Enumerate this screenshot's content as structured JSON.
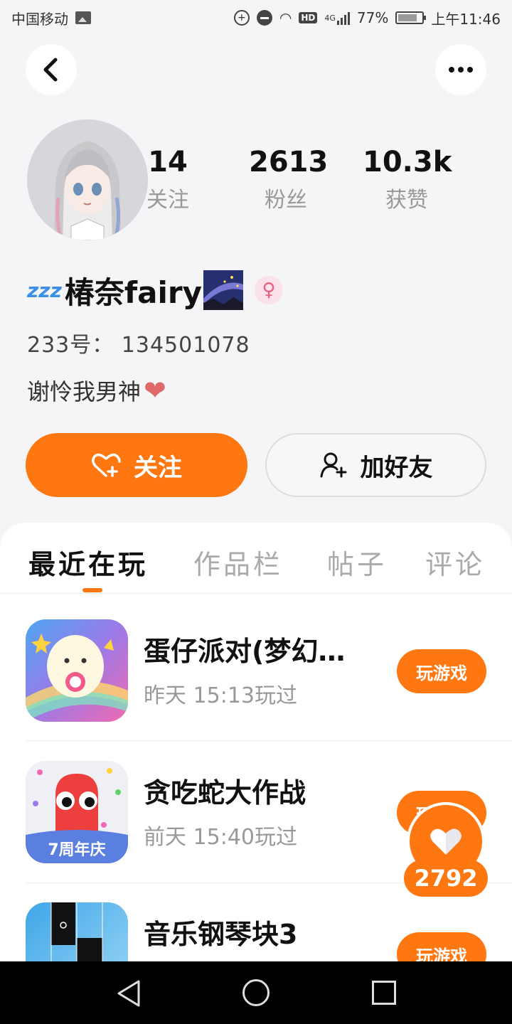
{
  "status_bar": {
    "carrier": "中国移动",
    "network": "4G",
    "battery": "77%",
    "time": "上午11:46"
  },
  "profile": {
    "stats": [
      {
        "value": "14",
        "label": "关注"
      },
      {
        "value": "2613",
        "label": "粉丝"
      },
      {
        "value": "10.3k",
        "label": "获赞"
      }
    ],
    "name_prefix": "zzz",
    "name": "椿奈fairy",
    "gender": "♀",
    "id_text": "233号： 134501078",
    "bio": "谢怜我男神",
    "bio_emoji": "❤"
  },
  "actions": {
    "follow_label": "关注",
    "add_friend_label": "加好友"
  },
  "tabs": [
    {
      "label": "最近在玩",
      "active": true
    },
    {
      "label": "作品栏",
      "active": false
    },
    {
      "label": "帖子",
      "active": false
    },
    {
      "label": "评论",
      "active": false
    }
  ],
  "games": [
    {
      "title": "蛋仔派对(梦幻…",
      "played": "昨天 15:13玩过",
      "button": "玩游戏",
      "icon": "eggy-party-icon"
    },
    {
      "title": "贪吃蛇大作战",
      "played": "前天 15:40玩过",
      "button": "玩游戏",
      "icon": "snake-game-icon",
      "badge": "7周年庆"
    },
    {
      "title": "音乐钢琴块3",
      "played": "",
      "button": "玩游戏",
      "icon": "piano-tiles-icon"
    }
  ],
  "floating_like": {
    "count": "2792"
  },
  "colors": {
    "accent": "#ff7711",
    "background": "#f5f5f7",
    "muted_text": "#999999"
  }
}
